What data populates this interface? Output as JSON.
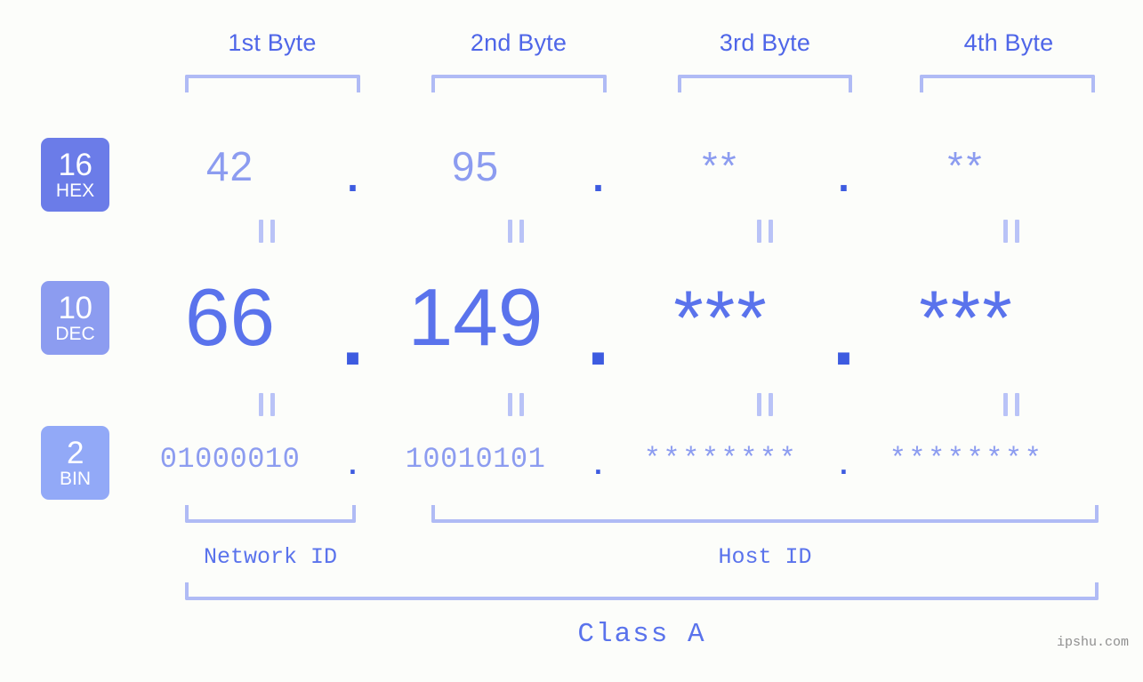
{
  "background_color": "#fcfdfa",
  "accent_colors": {
    "header_text": "#4f66e8",
    "bracket": "#b0bbf5",
    "hex_value": "#8c9cf0",
    "dec_value": "#5a73ec",
    "bin_value": "#8c9cf0",
    "dot": "#3d5be0",
    "badge_hex": "#6b7ce8",
    "badge_dec": "#8c9cf0",
    "badge_bin": "#92a9f7",
    "equals_mark": "#b9c3f7",
    "watermark": "#8f8f8f"
  },
  "byte_headers": [
    {
      "label": "1st Byte"
    },
    {
      "label": "2nd Byte"
    },
    {
      "label": "3rd Byte"
    },
    {
      "label": "4th Byte"
    }
  ],
  "bases": [
    {
      "radix": "16",
      "name": "HEX"
    },
    {
      "radix": "10",
      "name": "DEC"
    },
    {
      "radix": "2",
      "name": "BIN"
    }
  ],
  "separator": ".",
  "equals_symbol": "||",
  "rows": {
    "hex": {
      "values": [
        "42",
        "95",
        "**",
        "**"
      ]
    },
    "dec": {
      "values": [
        "66",
        "149",
        "***",
        "***"
      ]
    },
    "bin": {
      "values": [
        "01000010",
        "10010101",
        "********",
        "********"
      ]
    }
  },
  "segments": {
    "network_id": "Network ID",
    "host_id": "Host ID"
  },
  "class_label": "Class A",
  "watermark": "ipshu.com"
}
